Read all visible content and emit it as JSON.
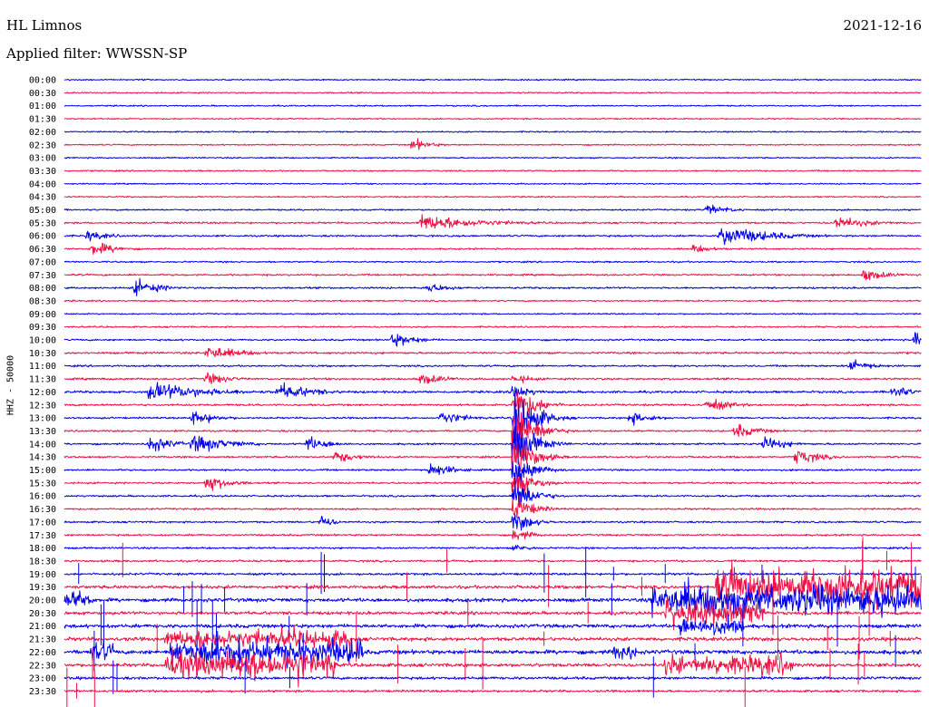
{
  "header": {
    "station": "HL Limnos",
    "date": "2021-12-16",
    "filter": "Applied filter: WWSSN-SP"
  },
  "chart_data": {
    "type": "line",
    "ylabel": "HHZ - 50000",
    "tick_labels": [
      "00:00",
      "00:30",
      "01:00",
      "01:30",
      "02:00",
      "02:30",
      "03:00",
      "03:30",
      "04:00",
      "04:30",
      "05:00",
      "05:30",
      "06:00",
      "06:30",
      "07:00",
      "07:30",
      "08:00",
      "08:30",
      "09:00",
      "09:30",
      "10:00",
      "10:30",
      "11:00",
      "11:30",
      "12:00",
      "12:30",
      "13:00",
      "13:30",
      "14:00",
      "14:30",
      "15:00",
      "15:30",
      "16:00",
      "16:30",
      "17:00",
      "17:30",
      "18:00",
      "18:30",
      "19:00",
      "19:30",
      "20:00",
      "20:30",
      "21:00",
      "21:30",
      "22:00",
      "22:30",
      "23:00",
      "23:30"
    ],
    "row_minutes": 30,
    "colors": {
      "even": "#0000ee",
      "odd": "#ee1144"
    },
    "noise_level": [
      0.6,
      0.6,
      0.6,
      0.6,
      0.6,
      0.6,
      0.6,
      0.6,
      0.6,
      0.6,
      0.7,
      0.8,
      0.8,
      0.7,
      0.7,
      0.8,
      0.8,
      0.7,
      0.6,
      0.7,
      0.8,
      0.9,
      0.8,
      0.9,
      1.0,
      0.9,
      0.8,
      0.8,
      0.8,
      0.8,
      0.8,
      0.8,
      0.8,
      0.8,
      0.8,
      0.8,
      0.8,
      0.9,
      1.0,
      1.4,
      1.6,
      1.4,
      1.6,
      1.6,
      1.8,
      1.5,
      1.2,
      1.0
    ],
    "events": [
      {
        "row": 5,
        "t": 12.2,
        "dur": 1.5,
        "amp": 6
      },
      {
        "row": 10,
        "t": 22.5,
        "dur": 2,
        "amp": 5
      },
      {
        "row": 11,
        "t": 12.5,
        "dur": 5,
        "amp": 8
      },
      {
        "row": 11,
        "t": 27,
        "dur": 3,
        "amp": 6
      },
      {
        "row": 12,
        "t": 23,
        "dur": 4,
        "amp": 10
      },
      {
        "row": 12,
        "t": 0.8,
        "dur": 2,
        "amp": 5
      },
      {
        "row": 13,
        "t": 22,
        "dur": 2,
        "amp": 4
      },
      {
        "row": 13,
        "t": 1,
        "dur": 2,
        "amp": 7
      },
      {
        "row": 15,
        "t": 28,
        "dur": 2,
        "amp": 6
      },
      {
        "row": 16,
        "t": 2.5,
        "dur": 2,
        "amp": 8
      },
      {
        "row": 16,
        "t": 12.7,
        "dur": 2,
        "amp": 5
      },
      {
        "row": 20,
        "t": 11.5,
        "dur": 2,
        "amp": 7
      },
      {
        "row": 20,
        "t": 29.8,
        "dur": 0.4,
        "amp": 10
      },
      {
        "row": 21,
        "t": 5,
        "dur": 3,
        "amp": 7
      },
      {
        "row": 22,
        "t": 27.5,
        "dur": 2,
        "amp": 6
      },
      {
        "row": 23,
        "t": 5,
        "dur": 2,
        "amp": 6
      },
      {
        "row": 23,
        "t": 12.5,
        "dur": 2,
        "amp": 6
      },
      {
        "row": 24,
        "t": 3,
        "dur": 5,
        "amp": 9
      },
      {
        "row": 24,
        "t": 7.5,
        "dur": 3,
        "amp": 8
      },
      {
        "row": 24,
        "t": 29,
        "dur": 1.5,
        "amp": 7
      },
      {
        "row": 25,
        "t": 22.5,
        "dur": 2,
        "amp": 7
      },
      {
        "row": 26,
        "t": 4.5,
        "dur": 2,
        "amp": 7
      },
      {
        "row": 26,
        "t": 13.2,
        "dur": 2,
        "amp": 7
      },
      {
        "row": 26,
        "t": 19.8,
        "dur": 2,
        "amp": 6
      },
      {
        "row": 27,
        "t": 23.5,
        "dur": 2,
        "amp": 7
      },
      {
        "row": 28,
        "t": 3,
        "dur": 2,
        "amp": 8
      },
      {
        "row": 28,
        "t": 4.5,
        "dur": 3,
        "amp": 9
      },
      {
        "row": 28,
        "t": 8.5,
        "dur": 2,
        "amp": 7
      },
      {
        "row": 28,
        "t": 24.5,
        "dur": 2,
        "amp": 7
      },
      {
        "row": 29,
        "t": 9.5,
        "dur": 2,
        "amp": 6
      },
      {
        "row": 29,
        "t": 25.6,
        "dur": 2,
        "amp": 8
      },
      {
        "row": 30,
        "t": 12.8,
        "dur": 2,
        "amp": 7
      },
      {
        "row": 31,
        "t": 5,
        "dur": 2,
        "amp": 8
      },
      {
        "row": 34,
        "t": 9,
        "dur": 1,
        "amp": 7
      }
    ],
    "big_event": {
      "t": 15.7,
      "rows": [
        23,
        24,
        25,
        26,
        27,
        28,
        29,
        30,
        31,
        32,
        33,
        34,
        35,
        36
      ],
      "amp": [
        4,
        6,
        18,
        26,
        24,
        20,
        18,
        14,
        12,
        14,
        10,
        8,
        5,
        3
      ]
    },
    "bursts": [
      {
        "row": 39,
        "t0": 22.8,
        "t1": 30,
        "amp": 22
      },
      {
        "row": 40,
        "t0": 0,
        "t1": 1,
        "amp": 10
      },
      {
        "row": 40,
        "t0": 20.5,
        "t1": 30,
        "amp": 18
      },
      {
        "row": 41,
        "t0": 21,
        "t1": 24.5,
        "amp": 14
      },
      {
        "row": 42,
        "t0": 21.5,
        "t1": 23.8,
        "amp": 12
      },
      {
        "row": 43,
        "t0": 3.5,
        "t1": 10,
        "amp": 10
      },
      {
        "row": 44,
        "t0": 3.7,
        "t1": 10.5,
        "amp": 14
      },
      {
        "row": 44,
        "t0": 0.9,
        "t1": 1.7,
        "amp": 10
      },
      {
        "row": 44,
        "t0": 19.2,
        "t1": 20,
        "amp": 10
      },
      {
        "row": 45,
        "t0": 3.5,
        "t1": 9.5,
        "amp": 16
      },
      {
        "row": 45,
        "t0": 21,
        "t1": 25.5,
        "amp": 12
      }
    ]
  }
}
